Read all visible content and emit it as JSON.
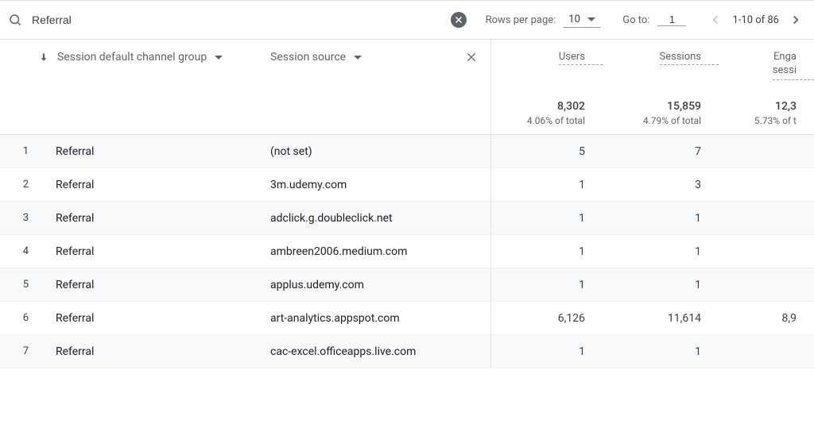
{
  "search": {
    "value": "Referral"
  },
  "toolbar": {
    "rows_per_page_label": "Rows per page:",
    "rows_per_page_value": "10",
    "goto_label": "Go to:",
    "goto_value": "1",
    "range_text": "1-10 of 86"
  },
  "columns": {
    "dim1": "Session default channel group",
    "dim2": "Session source",
    "m1": "Users",
    "m2": "Sessions",
    "m3_line1": "Enga",
    "m3_line2": "sessi"
  },
  "totals": {
    "m1_val": "8,302",
    "m1_pct": "4.06% of total",
    "m2_val": "15,859",
    "m2_pct": "4.79% of total",
    "m3_val": "12,3",
    "m3_pct": "5.73% of t"
  },
  "rows": [
    {
      "n": "1",
      "d1": "Referral",
      "d2": "(not set)",
      "m1": "5",
      "m2": "7",
      "m3": ""
    },
    {
      "n": "2",
      "d1": "Referral",
      "d2": "3m.udemy.com",
      "m1": "1",
      "m2": "3",
      "m3": ""
    },
    {
      "n": "3",
      "d1": "Referral",
      "d2": "adclick.g.doubleclick.net",
      "m1": "1",
      "m2": "1",
      "m3": ""
    },
    {
      "n": "4",
      "d1": "Referral",
      "d2": "ambreen2006.medium.com",
      "m1": "1",
      "m2": "1",
      "m3": ""
    },
    {
      "n": "5",
      "d1": "Referral",
      "d2": "applus.udemy.com",
      "m1": "1",
      "m2": "1",
      "m3": ""
    },
    {
      "n": "6",
      "d1": "Referral",
      "d2": "art-analytics.appspot.com",
      "m1": "6,126",
      "m2": "11,614",
      "m3": "8,9"
    },
    {
      "n": "7",
      "d1": "Referral",
      "d2": "cac-excel.officeapps.live.com",
      "m1": "1",
      "m2": "1",
      "m3": ""
    }
  ]
}
